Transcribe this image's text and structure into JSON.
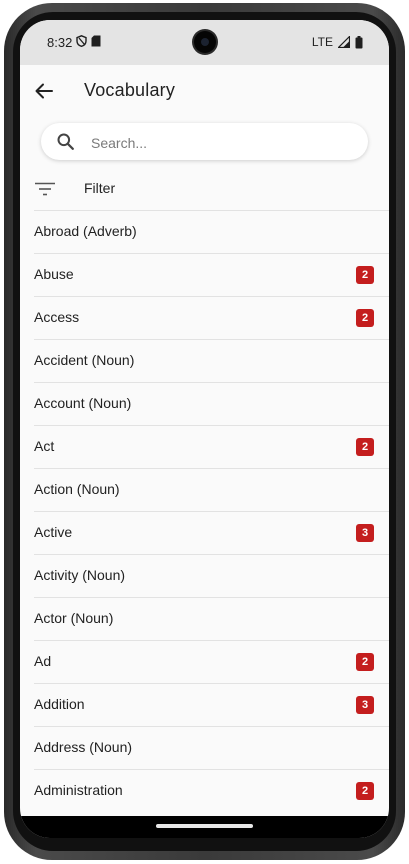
{
  "status_bar": {
    "time": "8:32",
    "network": "LTE"
  },
  "app_bar": {
    "title": "Vocabulary"
  },
  "search": {
    "placeholder": "Search..."
  },
  "filter": {
    "label": "Filter"
  },
  "words": [
    {
      "label": "Abroad (Adverb)",
      "badge": ""
    },
    {
      "label": "Abuse",
      "badge": "2"
    },
    {
      "label": "Access",
      "badge": "2"
    },
    {
      "label": "Accident (Noun)",
      "badge": ""
    },
    {
      "label": "Account (Noun)",
      "badge": ""
    },
    {
      "label": "Act",
      "badge": "2"
    },
    {
      "label": "Action (Noun)",
      "badge": ""
    },
    {
      "label": "Active",
      "badge": "3"
    },
    {
      "label": "Activity (Noun)",
      "badge": ""
    },
    {
      "label": "Actor (Noun)",
      "badge": ""
    },
    {
      "label": "Ad",
      "badge": "2"
    },
    {
      "label": "Addition",
      "badge": "3"
    },
    {
      "label": "Address (Noun)",
      "badge": ""
    },
    {
      "label": "Administration",
      "badge": "2"
    }
  ],
  "colors": {
    "badge": "#c41e1e",
    "status_bar": "#e4e4e4",
    "background": "#fafafa"
  }
}
